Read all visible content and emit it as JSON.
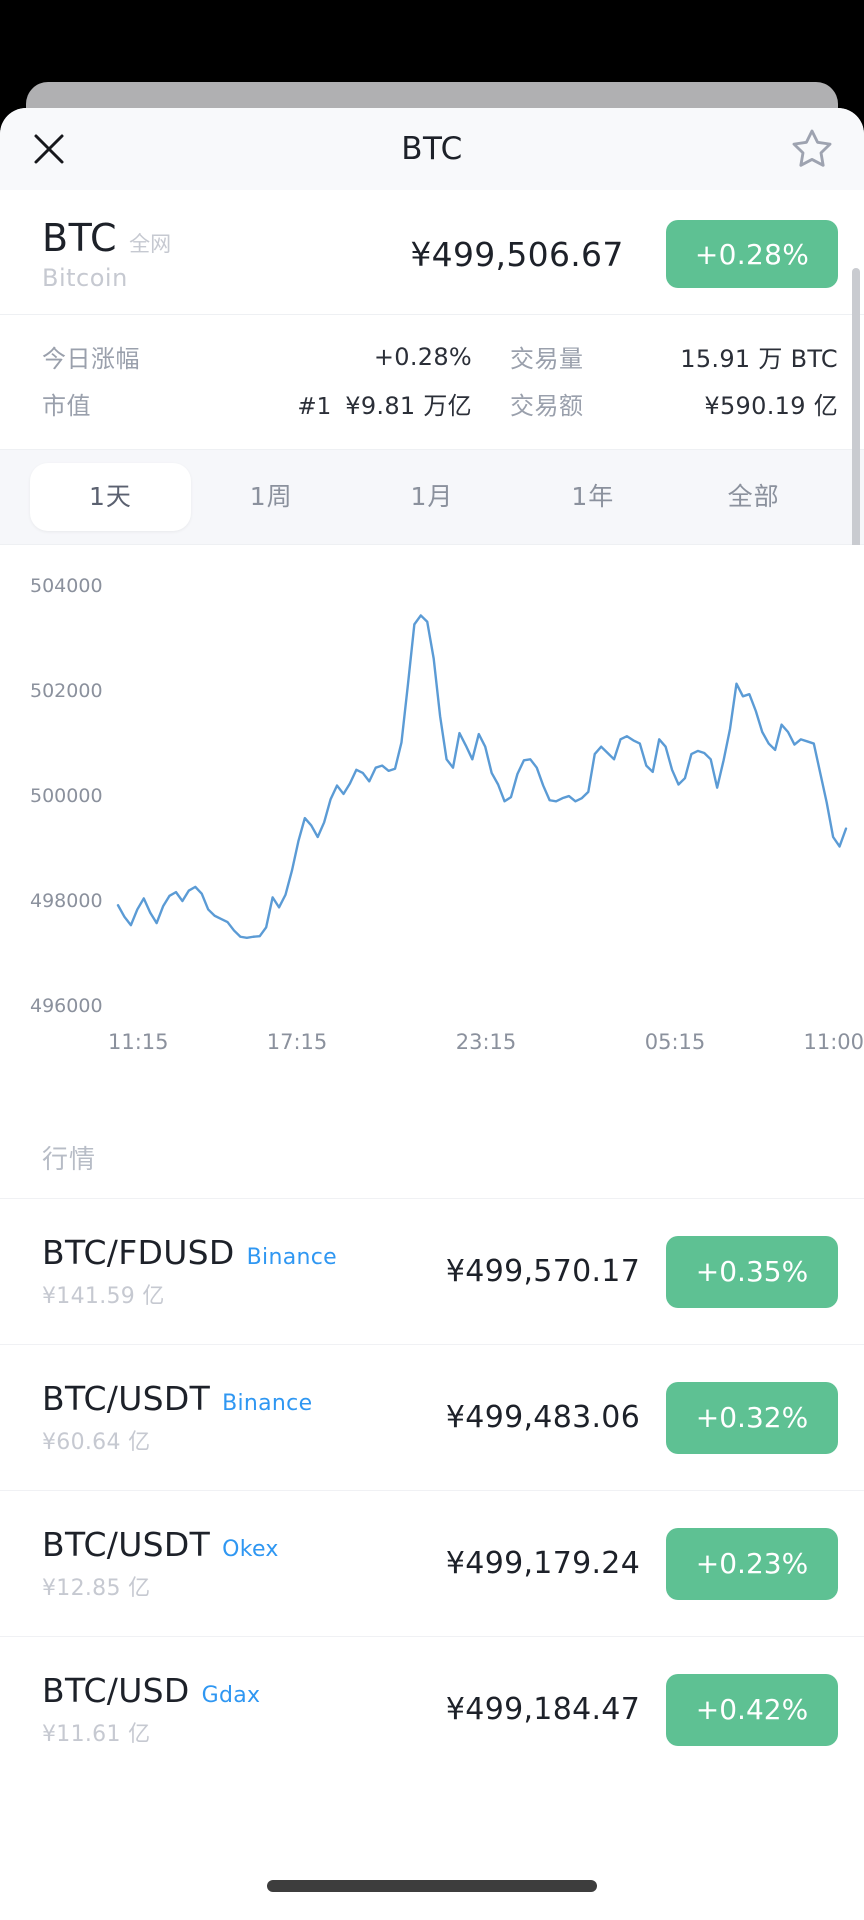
{
  "nav": {
    "title": "BTC",
    "close_icon": "close-icon",
    "favorite_icon": "star-outline-icon"
  },
  "summary": {
    "symbol": "BTC",
    "scope_tag": "全网",
    "name": "Bitcoin",
    "price": "¥499,506.67",
    "change": "+0.28%"
  },
  "stats": {
    "change_label": "今日涨幅",
    "change_value": "+0.28%",
    "volume_label": "交易量",
    "volume_value": "15.91 万 BTC",
    "marketcap_label": "市值",
    "marketcap_rank": "#1",
    "marketcap_value": "¥9.81 万亿",
    "turnover_label": "交易额",
    "turnover_value": "¥590.19 亿"
  },
  "tabs": [
    {
      "label": "1天",
      "active": true
    },
    {
      "label": "1周",
      "active": false
    },
    {
      "label": "1月",
      "active": false
    },
    {
      "label": "1年",
      "active": false
    },
    {
      "label": "全部",
      "active": false
    }
  ],
  "market": {
    "section_title": "行情",
    "rows": [
      {
        "pair": "BTC/FDUSD",
        "exchange": "Binance",
        "volume": "¥141.59 亿",
        "price": "¥499,570.17",
        "change": "+0.35%"
      },
      {
        "pair": "BTC/USDT",
        "exchange": "Binance",
        "volume": "¥60.64 亿",
        "price": "¥499,483.06",
        "change": "+0.32%"
      },
      {
        "pair": "BTC/USDT",
        "exchange": "Okex",
        "volume": "¥12.85 亿",
        "price": "¥499,179.24",
        "change": "+0.23%"
      },
      {
        "pair": "BTC/USD",
        "exchange": "Gdax",
        "volume": "¥11.61 亿",
        "price": "¥499,184.47",
        "change": "+0.42%"
      }
    ]
  },
  "colors": {
    "positive_green": "#5ec193",
    "line_blue": "#5b9bd5",
    "exchange_blue": "#2f97f2"
  },
  "chart_data": {
    "type": "line",
    "title": "",
    "xlabel": "",
    "ylabel": "",
    "ylim": [
      496000,
      504000
    ],
    "yticks": [
      496000,
      498000,
      500000,
      502000,
      504000
    ],
    "ytick_labels": [
      "496000",
      "498000",
      "500000",
      "502000",
      "504000"
    ],
    "xticks": [
      "11:15",
      "17:15",
      "23:15",
      "05:15",
      "11:00"
    ],
    "grid": false,
    "legend": "none",
    "series": [
      {
        "name": "BTC",
        "color": "#5b9bd5",
        "values": [
          497900,
          497680,
          497520,
          497820,
          498030,
          497760,
          497560,
          497880,
          498080,
          498150,
          497980,
          498180,
          498250,
          498120,
          497820,
          497700,
          497640,
          497580,
          497420,
          497300,
          497280,
          497300,
          497310,
          497480,
          498050,
          497860,
          498100,
          498560,
          499120,
          499560,
          499420,
          499200,
          499480,
          499920,
          500180,
          500020,
          500220,
          500480,
          500420,
          500260,
          500520,
          500560,
          500460,
          500500,
          501000,
          502100,
          503250,
          503420,
          503300,
          502600,
          501500,
          500680,
          500520,
          501180,
          500940,
          500680,
          501160,
          500920,
          500420,
          500200,
          499880,
          499960,
          500400,
          500660,
          500680,
          500520,
          500180,
          499900,
          499880,
          499940,
          499980,
          499880,
          499940,
          500060,
          500780,
          500920,
          500800,
          500680,
          501060,
          501120,
          501040,
          500980,
          500560,
          500440,
          501060,
          500920,
          500480,
          500200,
          500320,
          500780,
          500840,
          500800,
          500680,
          500140,
          500660,
          501260,
          502120,
          501880,
          501920,
          501600,
          501200,
          500980,
          500860,
          501340,
          501200,
          500960,
          501060,
          501020,
          500980,
          500420,
          499860,
          499200,
          499020,
          499360
        ]
      }
    ]
  }
}
